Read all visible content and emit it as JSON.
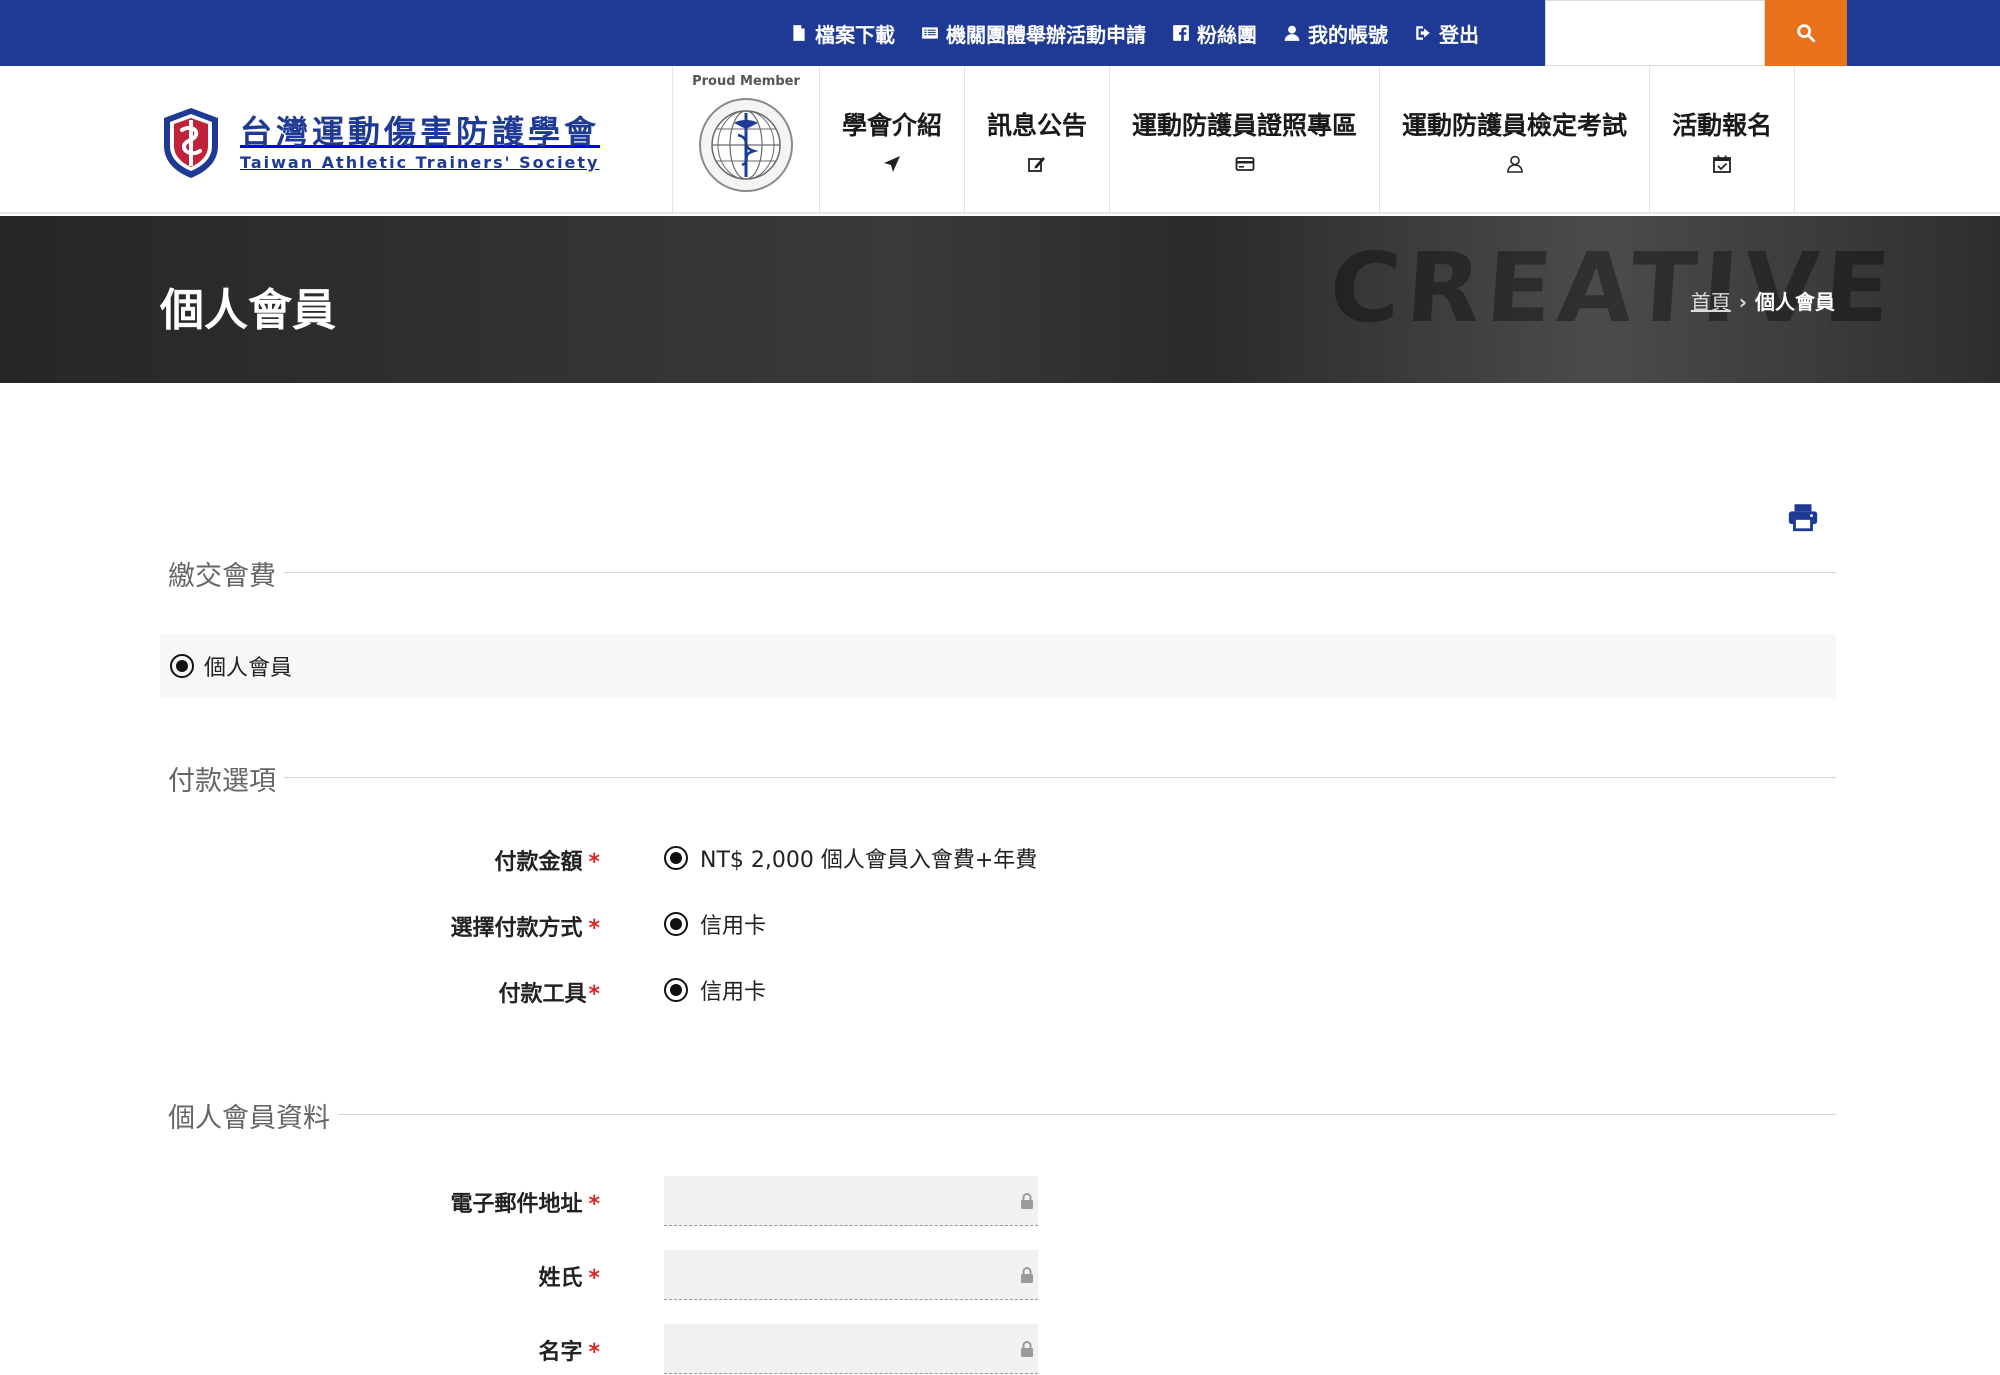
{
  "topnav": {
    "items": [
      {
        "label": "檔案下載",
        "icon": "file-icon"
      },
      {
        "label": "機關團體舉辦活動申請",
        "icon": "list-card-icon"
      },
      {
        "label": "粉絲團",
        "icon": "facebook-icon"
      },
      {
        "label": "我的帳號",
        "icon": "user-icon"
      },
      {
        "label": "登出",
        "icon": "logout-icon"
      }
    ],
    "search_placeholder": "",
    "search_icon": "search-icon"
  },
  "colors": {
    "topbar": "#1e3a94",
    "search_button": "#e8731c",
    "required": "#dd2222"
  },
  "logo": {
    "name_cn": "台灣運動傷害防護學會",
    "name_en": "Taiwan Athletic Trainers' Society"
  },
  "member_badge": {
    "label": "Proud Member"
  },
  "mainnav": {
    "items": [
      {
        "label": "學會介紹",
        "icon": "location-arrow-icon"
      },
      {
        "label": "訊息公告",
        "icon": "edit-icon"
      },
      {
        "label": "運動防護員證照專區",
        "icon": "credit-card-icon"
      },
      {
        "label": "運動防護員檢定考試",
        "icon": "user-outline-icon"
      },
      {
        "label": "活動報名",
        "icon": "calendar-check-icon"
      }
    ]
  },
  "banner": {
    "title": "個人會員",
    "deco_text": "CREATIVE",
    "breadcrumb": {
      "home": "首頁",
      "separator": "›",
      "current": "個人會員"
    }
  },
  "sections": {
    "fee": {
      "title": "繳交會費",
      "option": "個人會員"
    },
    "payment": {
      "title": "付款選項",
      "rows": [
        {
          "label": "付款金額",
          "required": "*",
          "value": "NT$ 2,000 個人會員入會費+年費"
        },
        {
          "label": "選擇付款方式",
          "required": "*",
          "value": "信用卡"
        },
        {
          "label": "付款工具",
          "required": "*",
          "value": "信用卡"
        }
      ]
    },
    "profile": {
      "title": "個人會員資料",
      "fields": [
        {
          "label": "電子郵件地址",
          "required": "*",
          "value": ""
        },
        {
          "label": "姓氏",
          "required": "*",
          "value": ""
        },
        {
          "label": "名字",
          "required": "*",
          "value": ""
        }
      ]
    }
  }
}
